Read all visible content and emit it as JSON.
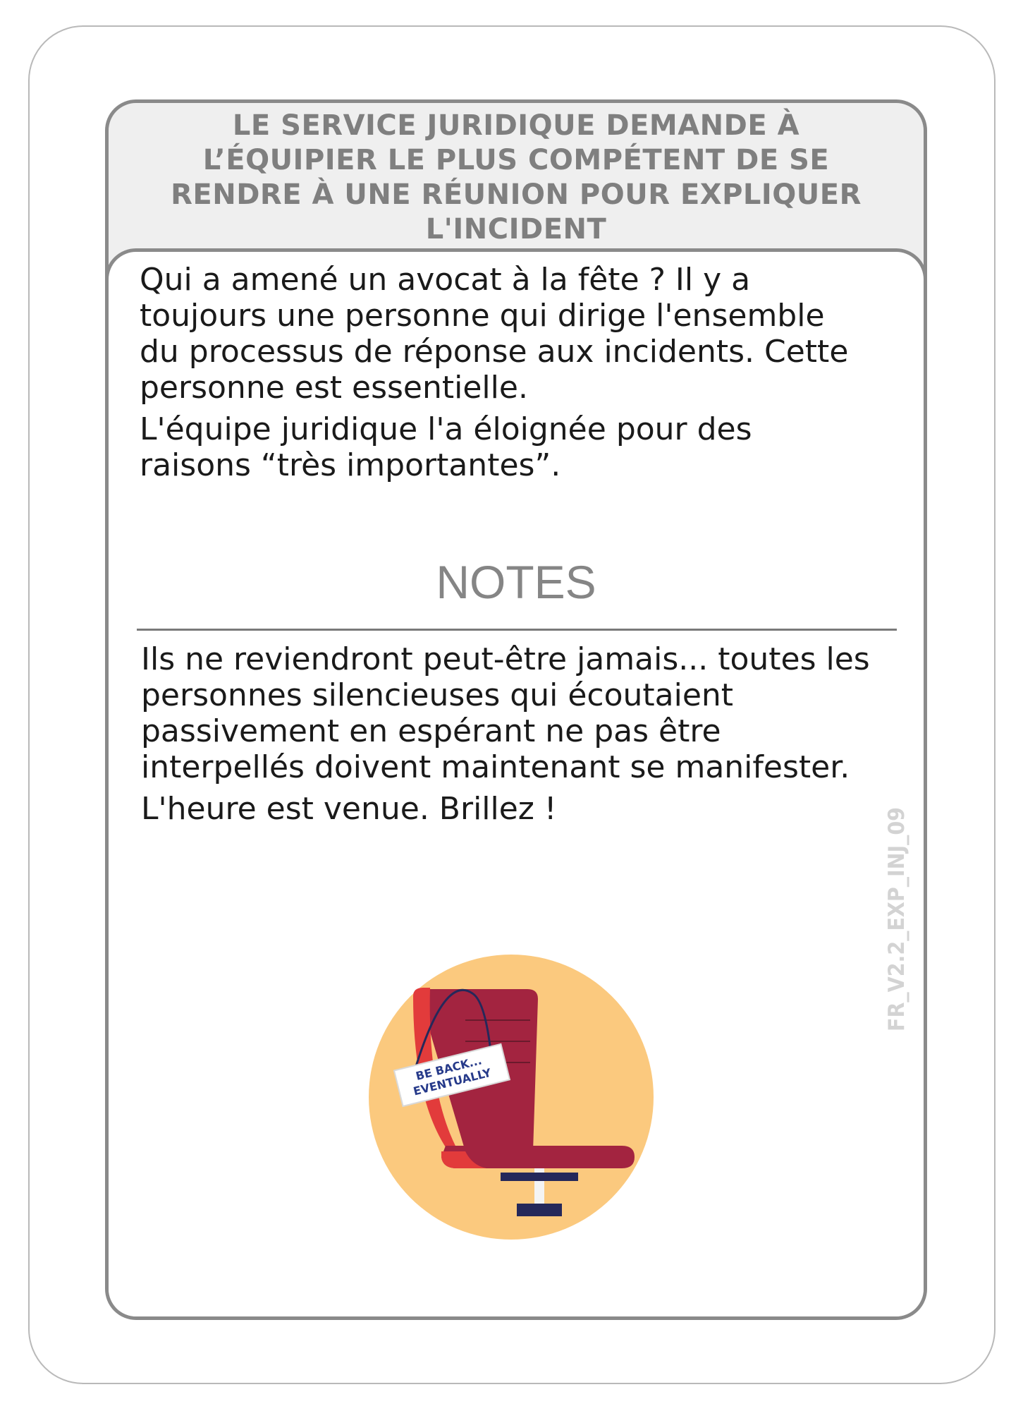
{
  "card": {
    "title_lines": [
      "LE SERVICE JURIDIQUE DEMANDE À",
      "L’ÉQUIPIER LE PLUS COMPÉTENT DE SE",
      "RENDRE À UNE RÉUNION POUR EXPLIQUER",
      "L'INCIDENT"
    ],
    "scenario": [
      {
        "lines": [
          "Qui a amené un avocat à la fête ? Il y a",
          "toujours une personne qui dirige l'ensemble",
          "du processus de réponse aux incidents. Cette",
          "personne est essentielle."
        ]
      },
      {
        "lines": [
          "L'équipe juridique l'a éloignée pour des",
          "raisons “très importantes”."
        ]
      }
    ],
    "notes_heading": "NOTES",
    "notes": [
      {
        "lines": [
          "Ils ne reviendront peut-être jamais... toutes les",
          "personnes silencieuses qui écoutaient",
          "passivement en espérant ne pas être",
          "interpellés doivent maintenant se manifester."
        ]
      },
      {
        "lines": [
          "L'heure est venue. Brillez !"
        ]
      }
    ],
    "card_code": "FR_V2.2_EXP_INJ_09",
    "illustration": {
      "sign_line_1": "BE BACK...",
      "sign_line_2": "EVENTUALLY",
      "icon": "office-chair-icon"
    },
    "colors": {
      "title_text": "#7f7f7f",
      "frame_border": "#8a8a8a",
      "title_background": "#efefef",
      "body_text": "#1a1a1a",
      "circle": "#fbc97e",
      "chair_back": "#a32440",
      "chair_side": "#e23b3b",
      "base": "#25285a",
      "sign_text": "#263a8a"
    }
  }
}
